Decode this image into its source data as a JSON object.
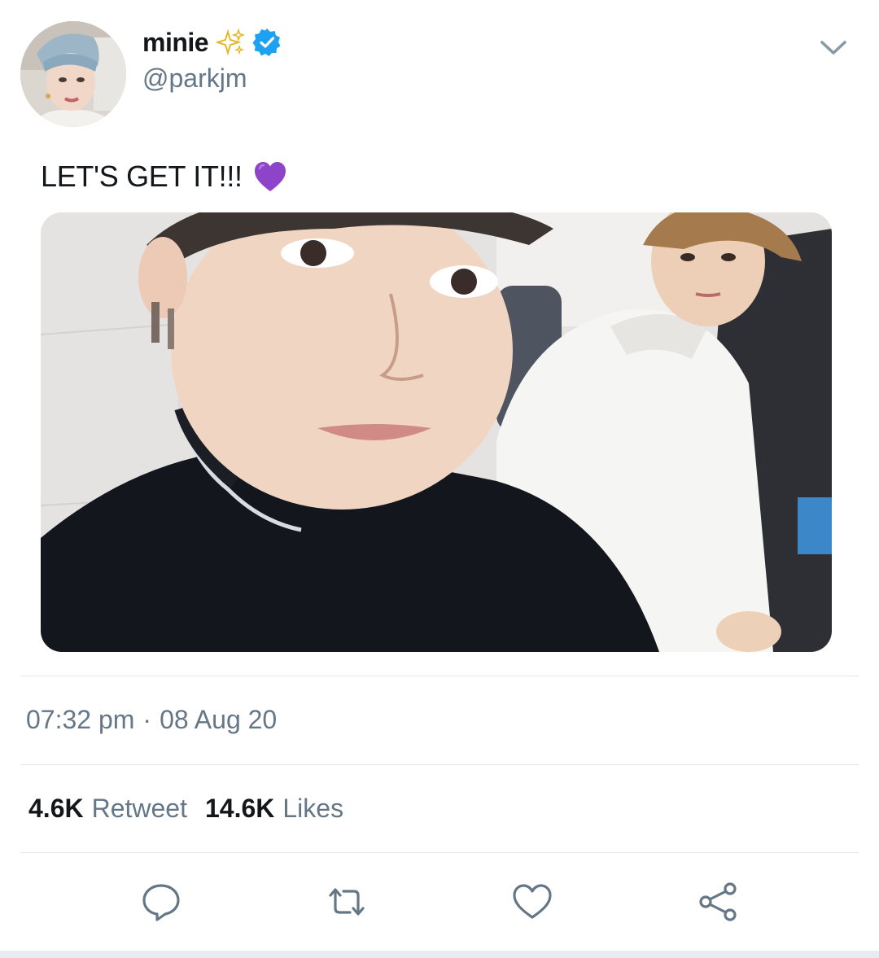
{
  "author": {
    "display_name": "minie",
    "handle": "@parkjm",
    "verified": true,
    "avatar_icon": "user-avatar-photo"
  },
  "tweet": {
    "text": "LET'S GET IT!!!",
    "emoji_icon": "purple-heart-emoji",
    "media_icon": "selfie-photo"
  },
  "meta": {
    "time": "07:32 pm",
    "separator": "·",
    "date": "08 Aug 20"
  },
  "stats": {
    "retweets_count": "4.6K",
    "retweets_label": "Retweet",
    "likes_count": "14.6K",
    "likes_label": "Likes"
  },
  "actions": [
    {
      "name": "reply",
      "icon": "speech-bubble-icon"
    },
    {
      "name": "retweet",
      "icon": "retweet-arrows-icon"
    },
    {
      "name": "like",
      "icon": "heart-outline-icon"
    },
    {
      "name": "share",
      "icon": "share-nodes-icon"
    }
  ],
  "colors": {
    "primary_text": "#14171a",
    "secondary_text": "#657786",
    "verified_blue": "#1da1f2",
    "divider": "#e1e8ed",
    "heart_purple": "#8e44c9",
    "sparkle_yellow": "#f4c542"
  }
}
